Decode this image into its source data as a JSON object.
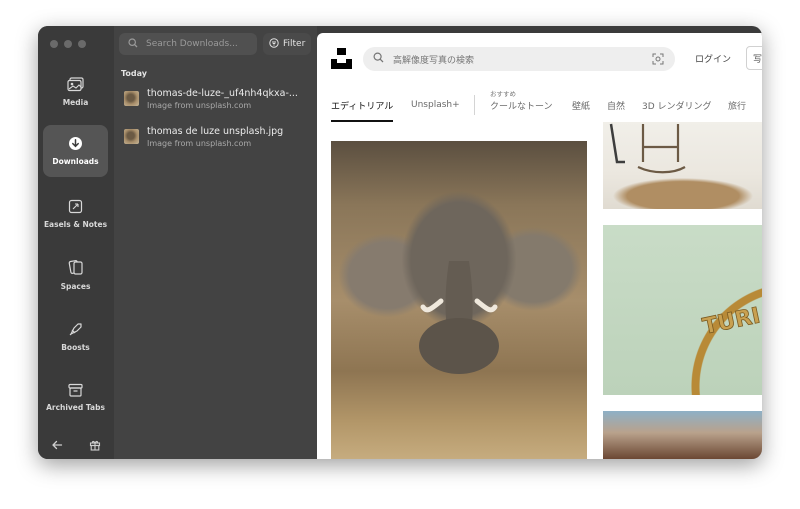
{
  "rail": {
    "items": [
      {
        "label": "Media",
        "icon": "media-icon"
      },
      {
        "label": "Downloads",
        "icon": "download-icon",
        "active": true
      },
      {
        "label": "Easels & Notes",
        "icon": "easel-icon"
      },
      {
        "label": "Spaces",
        "icon": "spaces-icon"
      },
      {
        "label": "Boosts",
        "icon": "boosts-icon"
      },
      {
        "label": "Archived Tabs",
        "icon": "archive-icon"
      }
    ]
  },
  "downloads": {
    "search_placeholder": "Search Downloads...",
    "filter_label": "Filter",
    "section_label": "Today",
    "items": [
      {
        "title": "thomas-de-luze-_uf4nh4qkxa-...",
        "subtitle": "Image from unsplash.com"
      },
      {
        "title": "thomas de luze unsplash.jpg",
        "subtitle": "Image from unsplash.com"
      }
    ]
  },
  "unsplash": {
    "search_placeholder": "高解像度写真の検索",
    "login_label": "ログイン",
    "cut_button_label": "写",
    "tabs": [
      {
        "label": "エディトリアル",
        "active": true
      },
      {
        "label": "Unsplash+"
      },
      {
        "label": "クールなトーン",
        "kicker": "おすすめ"
      },
      {
        "label": "壁紙"
      },
      {
        "label": "自然"
      },
      {
        "label": "3D レンダリング"
      },
      {
        "label": "旅行"
      }
    ],
    "photos": [
      "elephant-photo",
      "room-photo",
      "arch-sign-photo",
      "canyon-photo"
    ],
    "arch_sign_text": "TURI"
  },
  "colors": {
    "rail_bg": "#3a3a3a",
    "panel_bg": "#434343",
    "active_item_bg": "#555555",
    "accent": "#111111"
  }
}
